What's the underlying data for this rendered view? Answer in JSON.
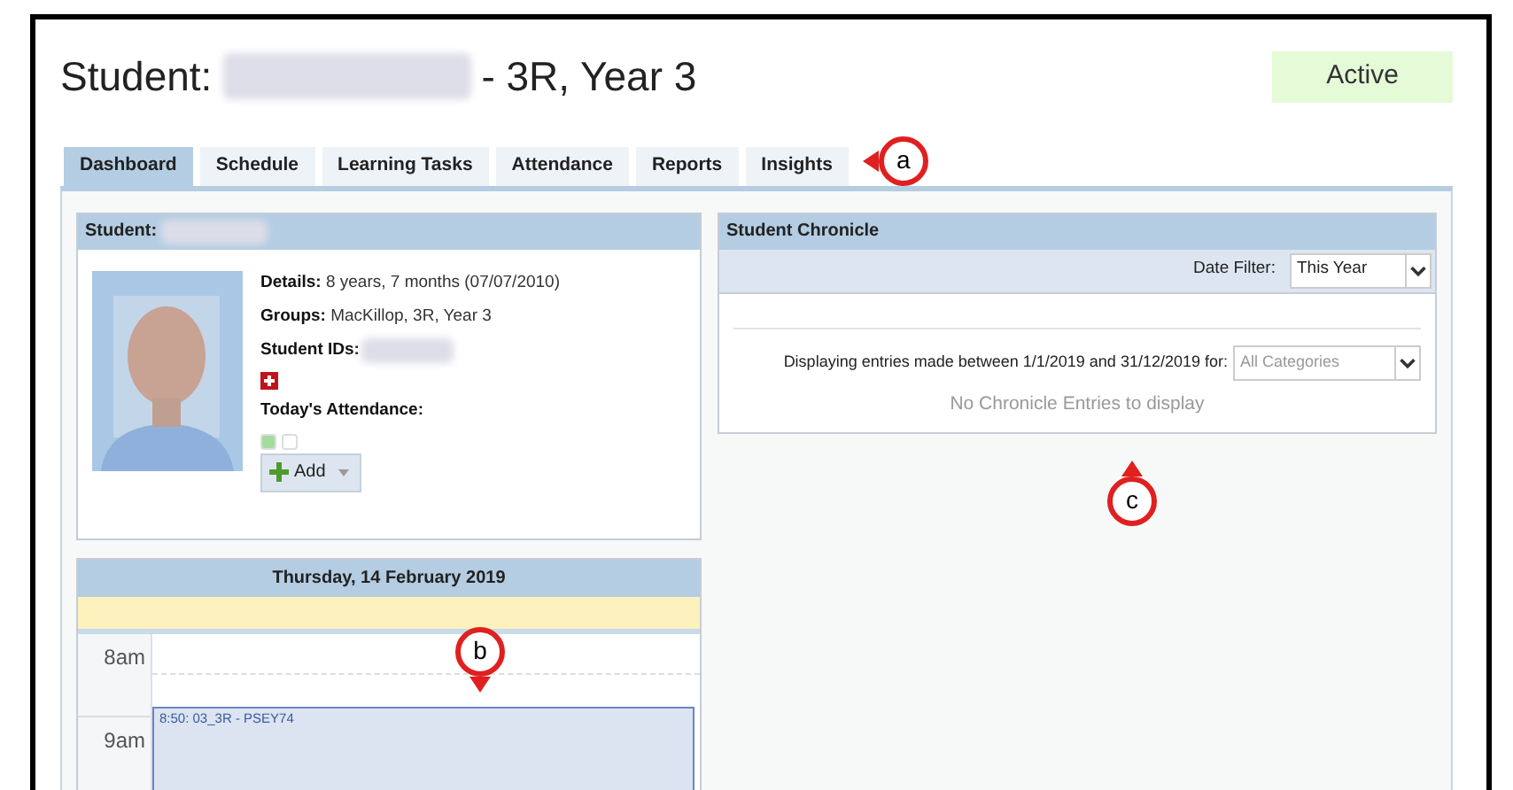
{
  "header": {
    "title_prefix": "Student:",
    "title_suffix": "- 3R, Year 3",
    "status": "Active"
  },
  "tabs": [
    {
      "label": "Dashboard",
      "selected": true
    },
    {
      "label": "Schedule",
      "selected": false
    },
    {
      "label": "Learning Tasks",
      "selected": false
    },
    {
      "label": "Attendance",
      "selected": false
    },
    {
      "label": "Reports",
      "selected": false
    },
    {
      "label": "Insights",
      "selected": false
    }
  ],
  "student_panel": {
    "title": "Student:",
    "details_label": "Details:",
    "details": "8 years, 7 months (07/07/2010)",
    "groups_label": "Groups:",
    "groups": "MacKillop, 3R, Year 3",
    "ids_label": "Student IDs:",
    "attendance_label": "Today's Attendance:",
    "attendance": [
      {
        "color": "#a6dba0"
      },
      {
        "color": "#ffffff"
      }
    ],
    "add_button": "Add"
  },
  "chronicle": {
    "title": "Student Chronicle",
    "date_filter_label": "Date Filter:",
    "date_filter": "This Year",
    "range_text": "Displaying entries made between 1/1/2019 and 31/12/2019 for:",
    "category": "All Categories",
    "empty": "No Chronicle Entries to display"
  },
  "calendar": {
    "date": "Thursday, 14 February 2019",
    "hours": [
      "8am",
      "9am"
    ],
    "event": "8:50: 03_3R - PSEY74"
  },
  "callouts": [
    "a",
    "b",
    "c"
  ]
}
